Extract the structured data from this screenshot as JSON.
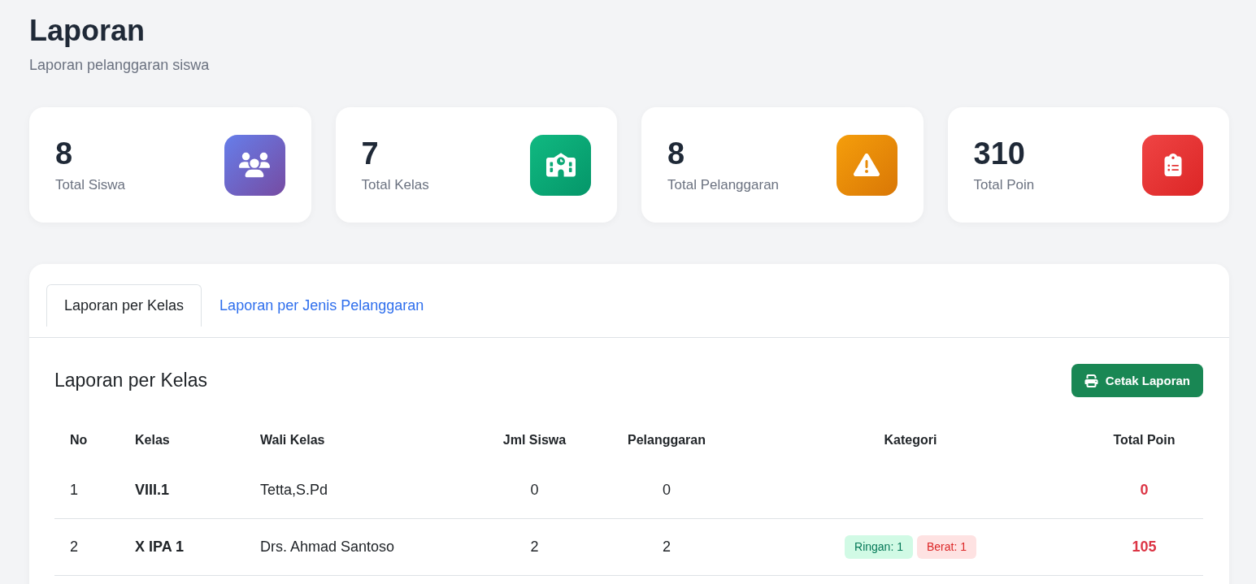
{
  "page": {
    "title": "Laporan",
    "subtitle": "Laporan pelanggaran siswa"
  },
  "stats": [
    {
      "kind": "people",
      "value": "8",
      "label": "Total Siswa"
    },
    {
      "kind": "school",
      "value": "7",
      "label": "Total Kelas"
    },
    {
      "kind": "warning",
      "value": "8",
      "label": "Total Pelanggaran"
    },
    {
      "kind": "clipboard",
      "value": "310",
      "label": "Total Poin"
    }
  ],
  "tabs": [
    {
      "label": "Laporan per Kelas",
      "selected": true
    },
    {
      "label": "Laporan per Jenis Pelanggaran",
      "selected": false
    }
  ],
  "report": {
    "title": "Laporan per Kelas",
    "print_button": "Cetak Laporan"
  },
  "table": {
    "columns": [
      "No",
      "Kelas",
      "Wali Kelas",
      "Jml Siswa",
      "Pelanggaran",
      "Kategori",
      "Total Poin"
    ],
    "rows": [
      {
        "no": "1",
        "class": "VIII.1",
        "homeroom_teacher": "Tetta,S.Pd",
        "students": "0",
        "violations": "0",
        "total_points": "0"
      },
      {
        "no": "2",
        "class": "X IPA 1",
        "homeroom_teacher": "Drs. Ahmad Santoso",
        "students": "2",
        "violations": "2",
        "categories": [
          {
            "kind": "light",
            "label": "Ringan: 1"
          },
          {
            "kind": "heavy",
            "label": "Berat: 1"
          }
        ],
        "total_points": "105"
      }
    ]
  }
}
